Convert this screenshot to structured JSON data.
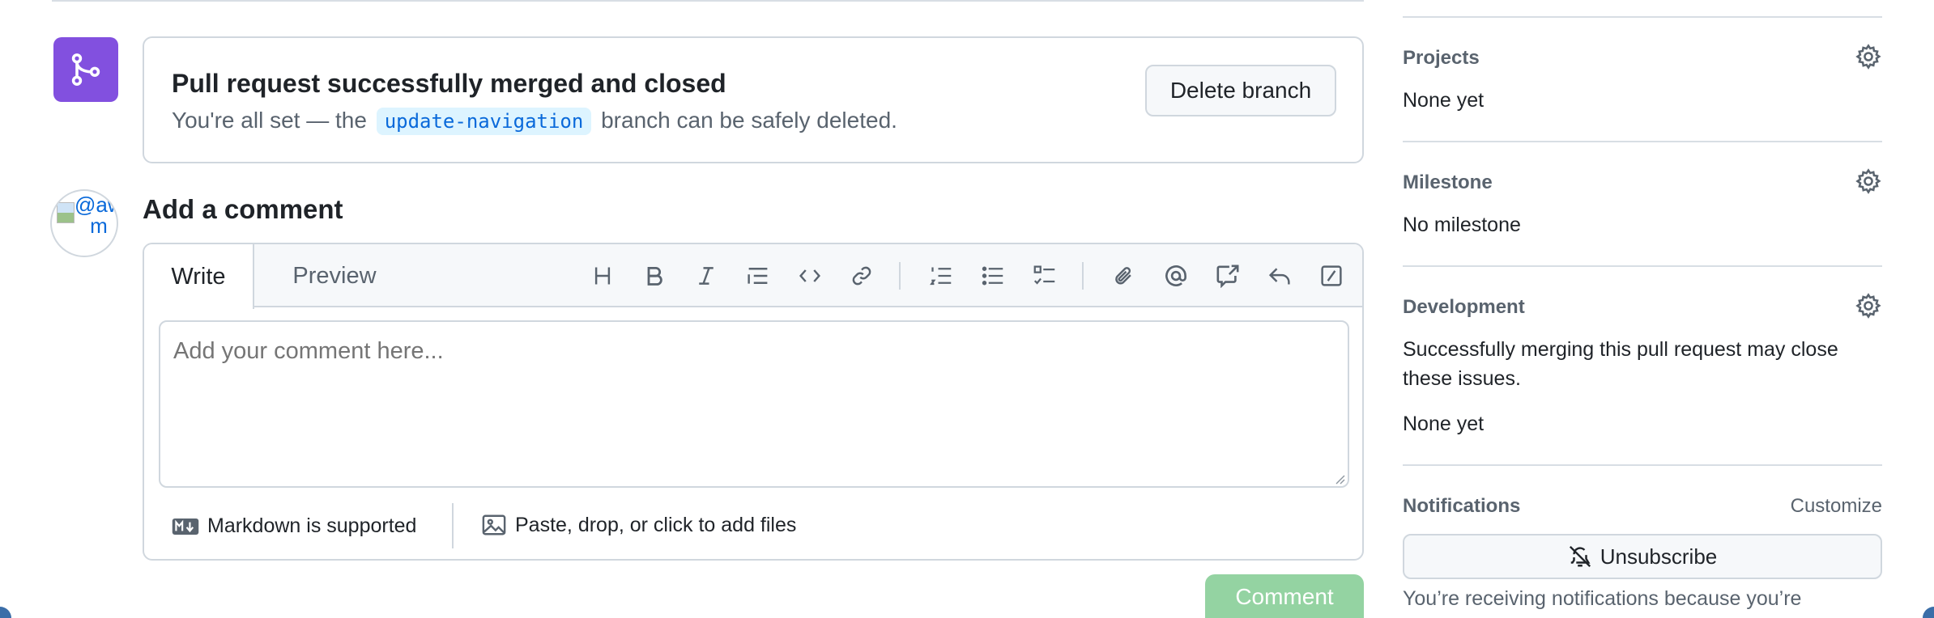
{
  "merge": {
    "title": "Pull request successfully merged and closed",
    "desc_before": "You're all set — the",
    "branch": "update-navigation",
    "desc_after": "branch can be safely deleted.",
    "delete_button": "Delete branch",
    "badge_icon": "git-merge-icon",
    "badge_color": "#8250df"
  },
  "comment": {
    "heading": "Add a comment",
    "avatar_alt": "@awel-m",
    "tabs": {
      "write": "Write",
      "preview": "Preview"
    },
    "placeholder": "Add your comment here...",
    "markdown_hint": "Markdown is supported",
    "files_hint": "Paste, drop, or click to add files",
    "submit": "Comment",
    "submit_color": "#94d3a2",
    "toolbar_icons": [
      "heading-icon",
      "bold-icon",
      "italic-icon",
      "quote-icon",
      "code-icon",
      "link-icon",
      "numbered-list-icon",
      "unordered-list-icon",
      "task-list-icon",
      "attach-icon",
      "mention-icon",
      "cross-reference-icon",
      "saved-reply-icon",
      "slash-command-icon"
    ]
  },
  "sidebar": {
    "projects": {
      "heading": "Projects",
      "value": "None yet"
    },
    "milestone": {
      "heading": "Milestone",
      "value": "No milestone"
    },
    "development": {
      "heading": "Development",
      "text_line1": "Successfully merging this pull request may close",
      "text_line2": "these issues.",
      "value": "None yet"
    },
    "notifications": {
      "heading": "Notifications",
      "customize": "Customize",
      "unsubscribe": "Unsubscribe",
      "note": "You’re receiving notifications because you’re"
    }
  }
}
